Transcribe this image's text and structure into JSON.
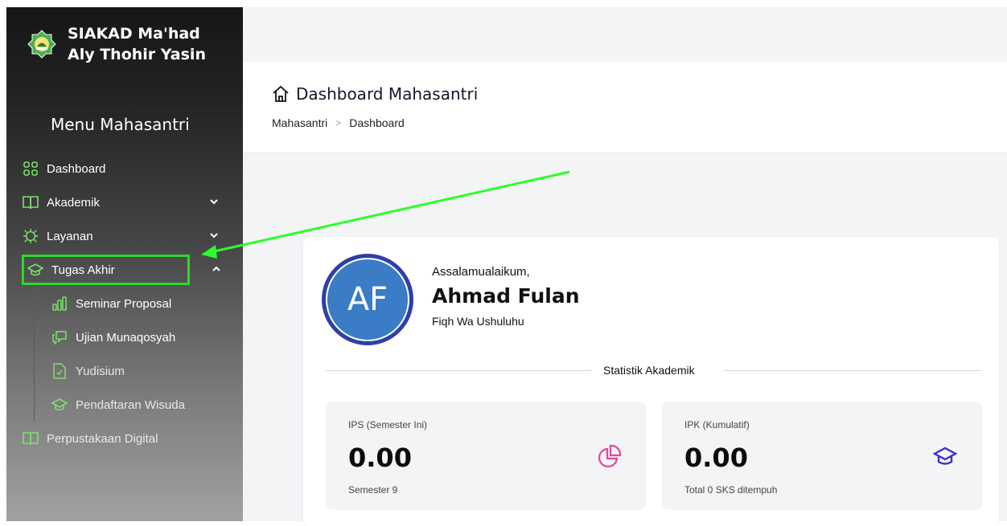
{
  "sidebar": {
    "brand": "SIAKAD Ma'had Aly Thohir Yasin",
    "menu_title": "Menu Mahasantri",
    "items": [
      {
        "label": "Dashboard"
      },
      {
        "label": "Akademik"
      },
      {
        "label": "Layanan"
      },
      {
        "label": "Tugas Akhir"
      }
    ],
    "sub_items": [
      {
        "label": "Seminar Proposal"
      },
      {
        "label": "Ujian Munaqosyah"
      },
      {
        "label": "Yudisium"
      },
      {
        "label": "Pendaftaran Wisuda"
      }
    ],
    "last_item": {
      "label": "Perpustakaan Digital"
    }
  },
  "header": {
    "title": "Dashboard Mahasantri",
    "breadcrumb": [
      "Mahasantri",
      "Dashboard"
    ]
  },
  "profile": {
    "initials": "AF",
    "greeting": "Assalamualaikum,",
    "name": "Ahmad Fulan",
    "program": "Fiqh Wa Ushuluhu"
  },
  "stats": {
    "section_label": "Statistik Akademik",
    "ips": {
      "label": "IPS (Semester Ini)",
      "value": "0.00",
      "footer": "Semester 9"
    },
    "ipk": {
      "label": "IPK (Kumulatif)",
      "value": "0.00",
      "footer": "Total 0 SKS ditempuh"
    }
  },
  "colors": {
    "highlight": "#2bd92b",
    "icon_green": "#7ee06f",
    "pink": "#e0489c",
    "indigo": "#3b2fd0"
  }
}
